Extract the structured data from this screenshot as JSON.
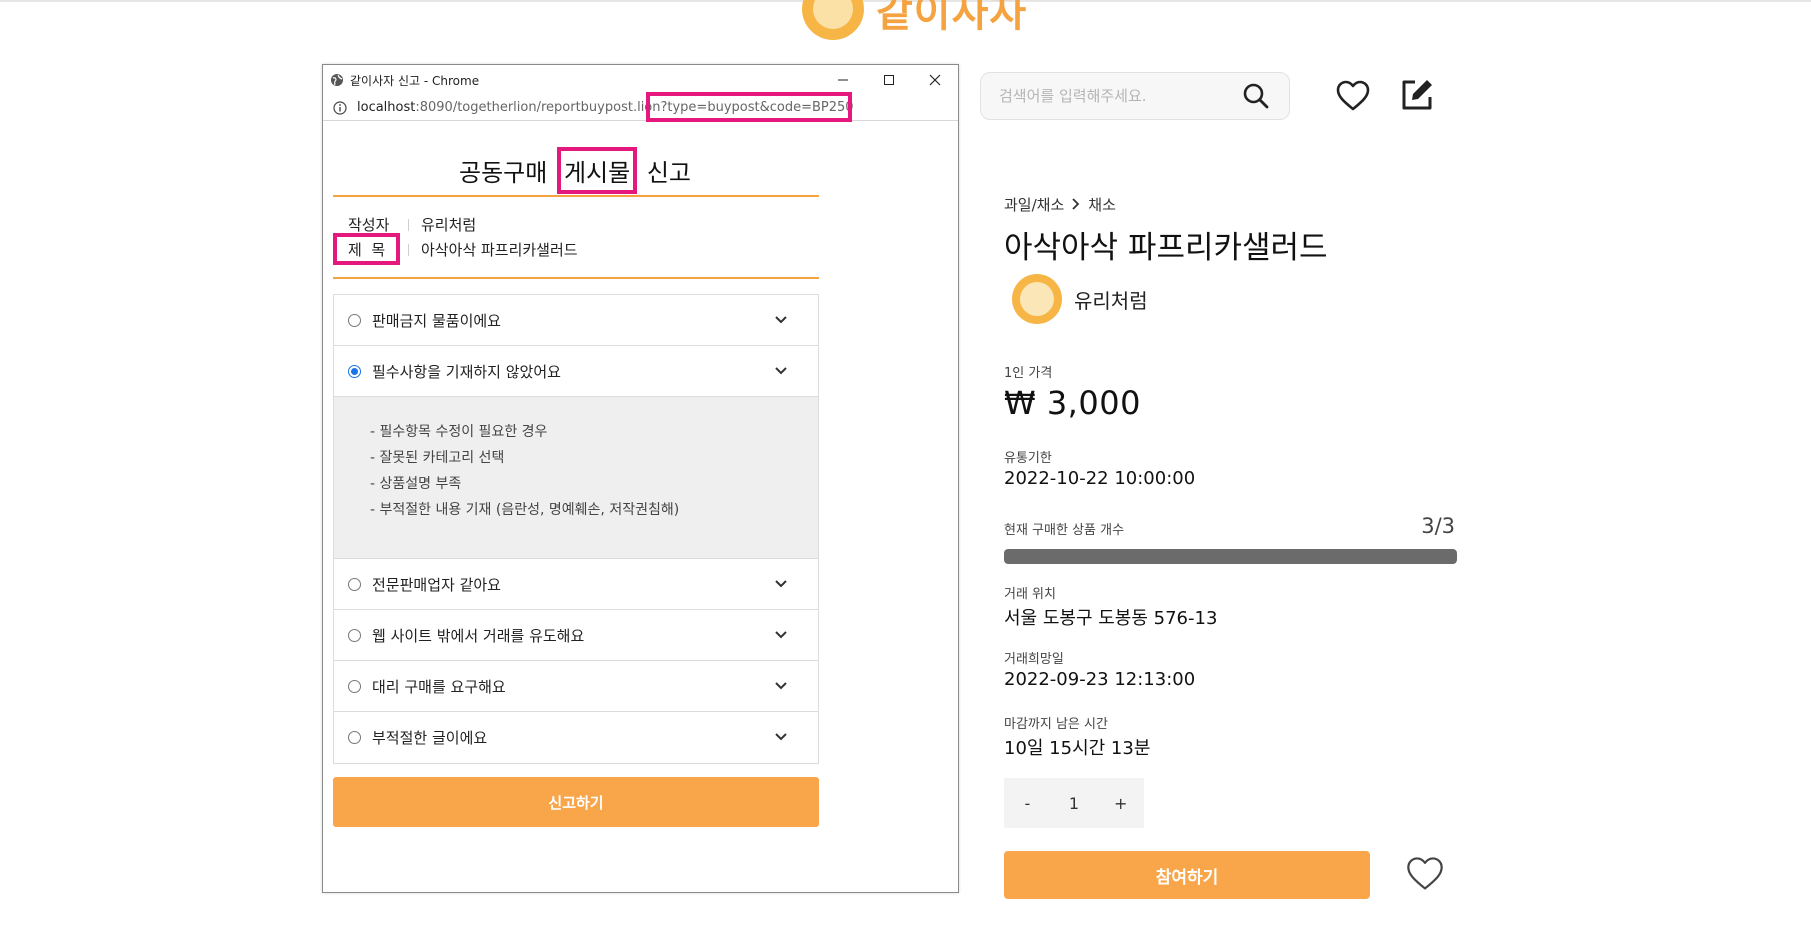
{
  "site": {
    "logo_text": "같이사자",
    "search_placeholder": "검색어를 입력해주세요."
  },
  "product": {
    "category": "과일/채소",
    "subcategory": "채소",
    "title": "아삭아삭 파프리카샐러드",
    "seller": "유리처럼",
    "price_label": "1인 가격",
    "price": "₩ 3,000",
    "expiry_label": "유통기한",
    "expiry": "2022-10-22 10:00:00",
    "count_label": "현재 구매한 상품 개수",
    "count": "3/3",
    "purchased": 3,
    "capacity": 3,
    "location_label": "거래 위치",
    "location": "서울 도봉구 도봉동 576-13",
    "date_label": "거래희망일",
    "date": "2022-09-23 12:13:00",
    "remaining_label": "마감까지 남은 시간",
    "remaining": "10일 15시간 13분",
    "qty_minus": "-",
    "qty": "1",
    "qty_plus": "+",
    "join_button": "참여하기"
  },
  "popup": {
    "window_title": "같이사자 신고 - Chrome",
    "url_host": "localhost",
    "url_rest": ":8090/togetherlion/reportbuypost.lion?type=buypost&code=BP250",
    "title_pre": "공동구매 ",
    "title_post": "게시물",
    "title_tail": " 신고",
    "author_label": "작성자",
    "author": "유리처럼",
    "subject_label": "제  목",
    "subject": "아삭아삭 파프리카샐러드",
    "reasons": [
      "판매금지 물품이에요",
      "필수사항을 기재하지 않았어요",
      "전문판매업자 같아요",
      "웹 사이트 밖에서 거래를 유도해요",
      "대리 구매를 요구해요",
      "부적절한 글이에요"
    ],
    "details": [
      "- 필수항목 수정이 필요한 경우",
      "- 잘못된 카테고리 선택",
      "- 상품설명 부족",
      "- 부적절한 내용 기재 (음란성, 명예훼손, 저작권침해)"
    ],
    "submit": "신고하기"
  },
  "colors": {
    "accent": "#f9a64a",
    "highlight": "#e5197d",
    "progress": "#6b6b6b"
  }
}
